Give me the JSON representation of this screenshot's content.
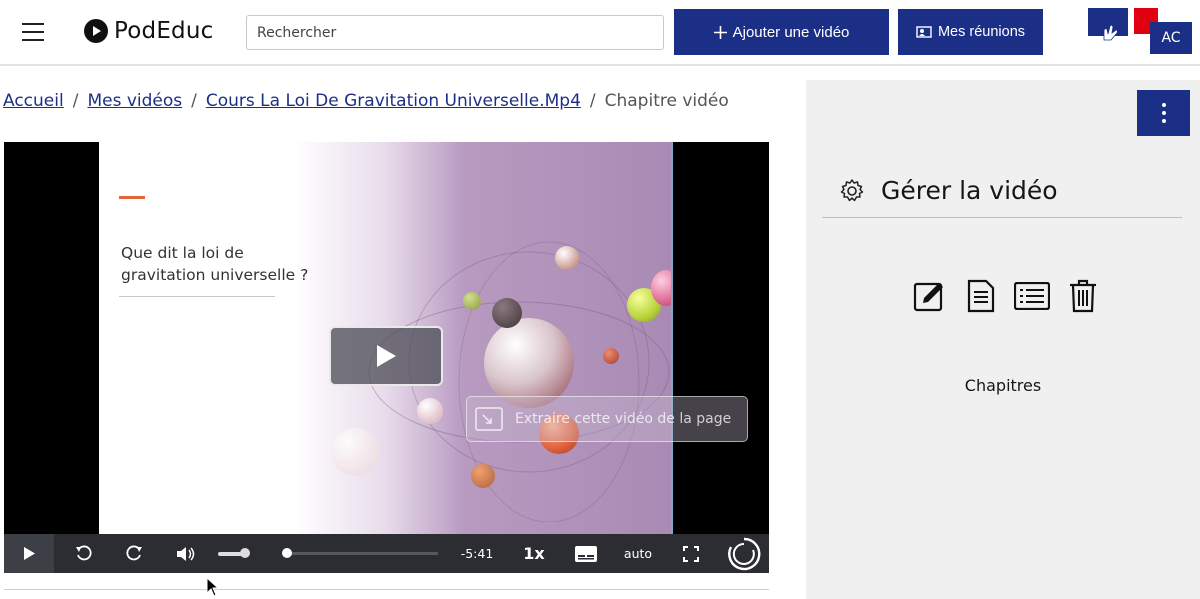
{
  "header": {
    "logo_text": "PodEduc",
    "search_placeholder": "Rechercher",
    "add_video_label": "Ajouter une vidéo",
    "meetings_label": "Mes réunions",
    "user_initials": "AC"
  },
  "breadcrumb": {
    "items": [
      "Accueil",
      "Mes vidéos",
      "Cours La Loi De Gravitation Universelle.Mp4"
    ],
    "separator": "/",
    "current": "Chapitre vidéo"
  },
  "video": {
    "slide_text_line1": "Que dit la loi de",
    "slide_text_line2": "gravitation universelle ?",
    "pip_label": "Extraire cette vidéo de la page",
    "time_remaining": "-5:41",
    "playback_rate": "1x",
    "quality": "auto",
    "progress": 0.0
  },
  "side": {
    "title": "Gérer la vidéo",
    "chapters_label": "Chapitres"
  },
  "colors": {
    "brand_blue": "#1c2f87",
    "accent_red": "#e1000f",
    "slide_accent": "#e5653a"
  }
}
